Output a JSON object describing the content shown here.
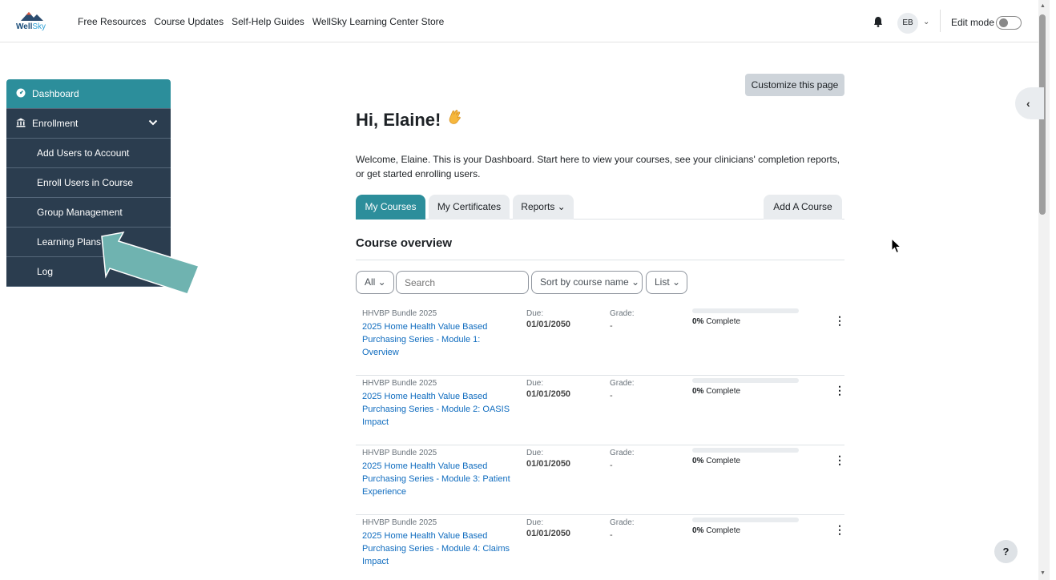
{
  "brand": {
    "logo_text_a": "Well",
    "logo_text_b": "Sky"
  },
  "nav": {
    "links": [
      "Free Resources",
      "Course Updates",
      "Self-Help Guides",
      "WellSky Learning Center Store"
    ],
    "avatar_initials": "EB",
    "edit_mode_label": "Edit mode"
  },
  "sidebar": {
    "items": [
      {
        "label": "Dashboard",
        "icon": "dashboard-icon"
      },
      {
        "label": "Enrollment",
        "icon": "building-icon"
      },
      {
        "label": "Add Users to Account"
      },
      {
        "label": "Enroll Users in Course"
      },
      {
        "label": "Group Management"
      },
      {
        "label": "Learning Plans"
      },
      {
        "label": "Log"
      }
    ]
  },
  "main": {
    "customize_label": "Customize this page",
    "greeting": "Hi, Elaine!",
    "welcome_text": "Welcome, Elaine. This is your Dashboard. Start here to view your courses, see your clinicians' completion reports, or get started enrolling users.",
    "tabs": [
      "My Courses",
      "My Certificates",
      "Reports ⌄",
      "Add A Course"
    ],
    "overview_title": "Course overview",
    "filters": {
      "all": "All ⌄",
      "search_placeholder": "Search",
      "sort": "Sort by course name ⌄",
      "view": "List ⌄"
    },
    "courses": [
      {
        "category": "HHVBP Bundle 2025",
        "name": "2025 Home Health Value Based Purchasing Series - Module 1: Overview",
        "due_label": "Due:",
        "due": "01/01/2050",
        "grade_label": "Grade:",
        "grade": "-",
        "progress_pct": "0%",
        "progress_suffix": "Complete",
        "progress": 0
      },
      {
        "category": "HHVBP Bundle 2025",
        "name": "2025 Home Health Value Based Purchasing Series - Module 2: OASIS Impact",
        "due_label": "Due:",
        "due": "01/01/2050",
        "grade_label": "Grade:",
        "grade": "-",
        "progress_pct": "0%",
        "progress_suffix": "Complete",
        "progress": 0
      },
      {
        "category": "HHVBP Bundle 2025",
        "name": "2025 Home Health Value Based Purchasing Series - Module 3: Patient Experience",
        "due_label": "Due:",
        "due": "01/01/2050",
        "grade_label": "Grade:",
        "grade": "-",
        "progress_pct": "0%",
        "progress_suffix": "Complete",
        "progress": 0
      },
      {
        "category": "HHVBP Bundle 2025",
        "name": "2025 Home Health Value Based Purchasing Series - Module 4: Claims Impact",
        "due_label": "Due:",
        "due": "01/01/2050",
        "grade_label": "Grade:",
        "grade": "-",
        "progress_pct": "0%",
        "progress_suffix": "Complete",
        "progress": 0
      }
    ]
  },
  "help_label": "?",
  "colors": {
    "accent": "#2c8e9b",
    "sidebar_bg": "#2b3d4f",
    "link": "#0f6cbf",
    "annotation_arrow": "#6fb3b0"
  }
}
